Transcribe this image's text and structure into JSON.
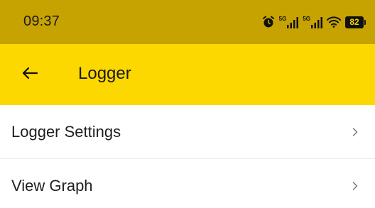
{
  "status_bar": {
    "time": "09:37",
    "signal_1_label": "5G",
    "signal_2_label": "5G",
    "battery_level": "82",
    "icons": [
      "alarm-icon",
      "signal-5g-icon",
      "signal-5g-icon",
      "wifi-icon",
      "battery-icon"
    ]
  },
  "app_bar": {
    "title": "Logger",
    "back_icon": "arrow-back-icon"
  },
  "list": {
    "items": [
      {
        "label": "Logger Settings",
        "icon": "chevron-right-icon"
      },
      {
        "label": "View Graph",
        "icon": "chevron-right-icon"
      }
    ]
  },
  "colors": {
    "status_bar": "#c6a300",
    "app_bar": "#fcd800",
    "background": "#ffffff",
    "text": "#1f1f1f"
  }
}
